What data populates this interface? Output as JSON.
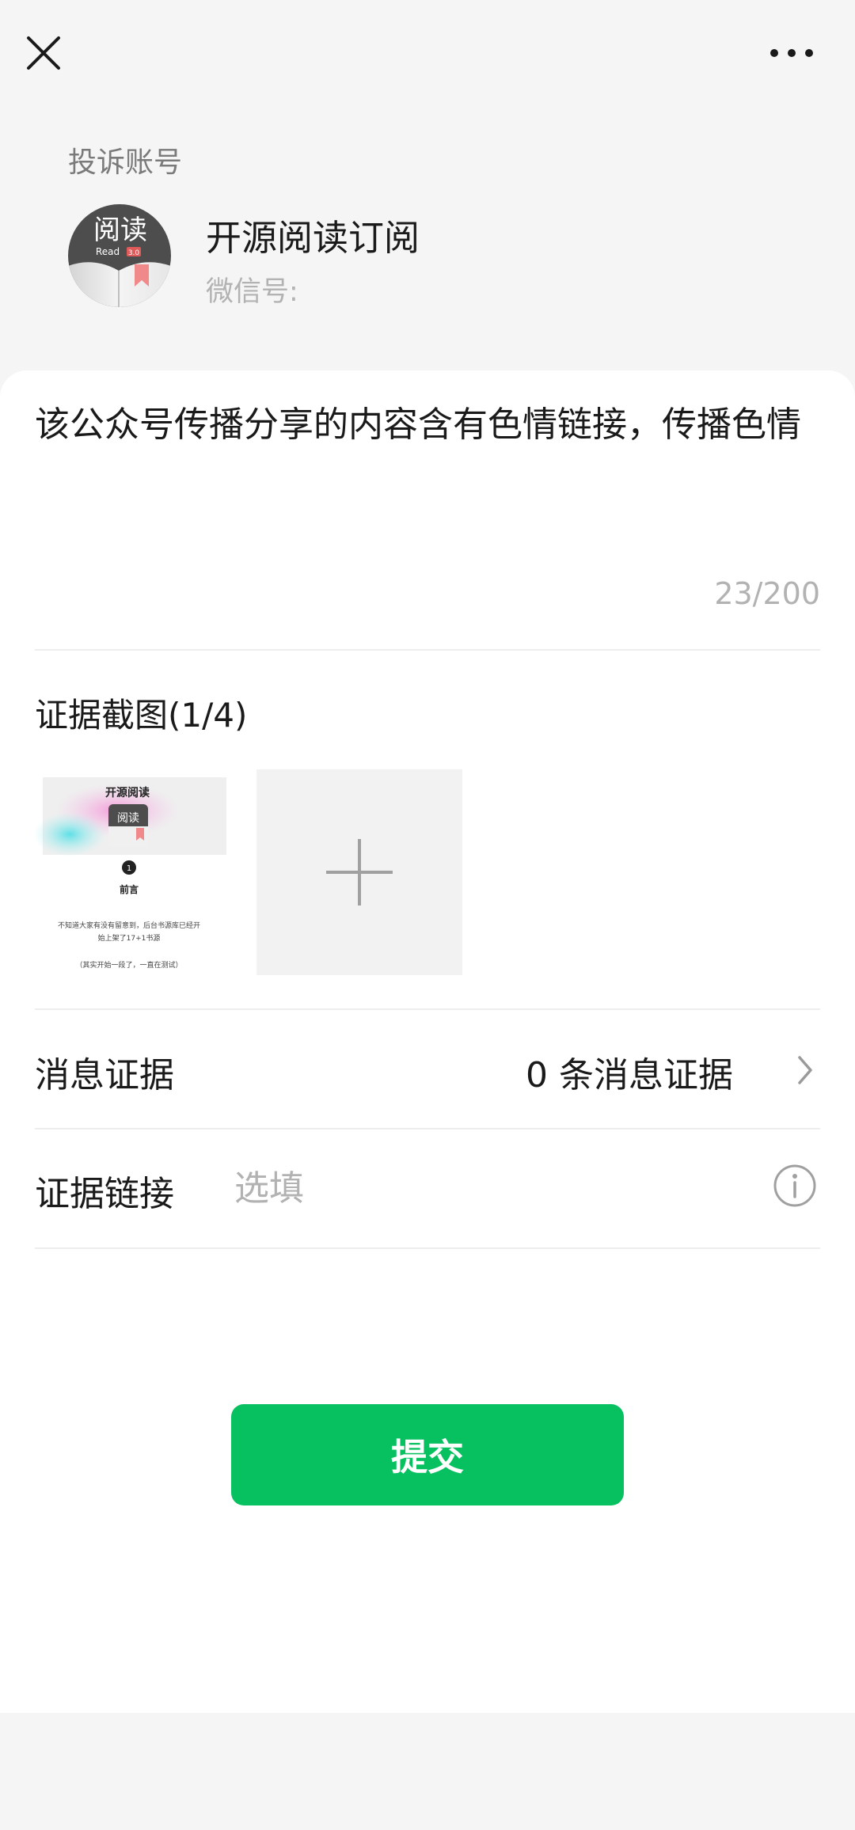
{
  "header": {
    "close_icon": "close-icon",
    "more_icon": "more-icon"
  },
  "account": {
    "section_label": "投诉账号",
    "avatar_text": "阅读",
    "avatar_subtext": "Read",
    "avatar_badge": "3.0",
    "name": "开源阅读订阅",
    "wechat_id_label": "微信号:"
  },
  "complaint": {
    "text": "该公众号传播分享的内容含有色情链接，传播色情",
    "char_count": "23/200"
  },
  "evidence_screenshots": {
    "title": "证据截图(1/4)",
    "thumbnail": {
      "title": "开源阅读",
      "app_icon_text": "阅读",
      "step_number": "1",
      "heading": "前言",
      "body_line1": "不知道大家有没有留意到，后台书源库已经开",
      "body_line2": "始上架了17+1书源",
      "note": "（其实开始一段了，一直在测试）"
    },
    "add_icon": "plus-icon"
  },
  "message_evidence": {
    "label": "消息证据",
    "value": "0 条消息证据",
    "chevron_icon": "chevron-right-icon"
  },
  "evidence_link": {
    "label": "证据链接",
    "placeholder": "选填",
    "info_icon": "info-icon"
  },
  "submit": {
    "label": "提交"
  },
  "colors": {
    "background": "#f5f5f5",
    "card": "#ffffff",
    "primary_green": "#07c160",
    "muted_text": "#b2b2b2"
  }
}
